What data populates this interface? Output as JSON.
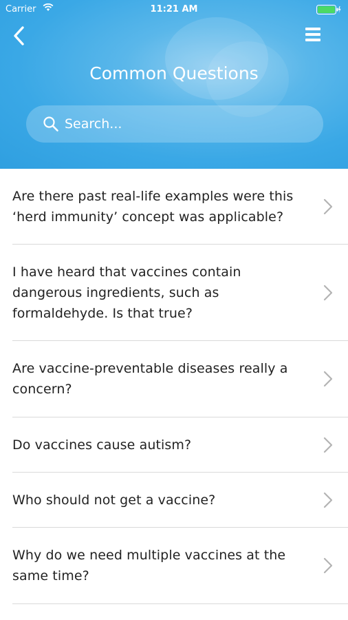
{
  "status_bar": {
    "carrier": "Carrier",
    "time": "11:21 AM"
  },
  "header": {
    "title": "Common Questions",
    "search_placeholder": "Search..."
  },
  "questions": [
    {
      "text": "Are there past real-life examples were this ‘herd immunity’ concept was applicable?"
    },
    {
      "text": "I have heard that vaccines contain dangerous ingredients, such as formaldehyde. Is that true?"
    },
    {
      "text": "Are vaccine-preventable diseases really a concern?"
    },
    {
      "text": "Do vaccines cause autism?"
    },
    {
      "text": "Who should not get a vaccine?"
    },
    {
      "text": "Why do we need multiple vaccines at the same time?"
    }
  ],
  "colors": {
    "header": "#3aa8e6",
    "battery": "#4cd964",
    "chevron": "#b3b3b3",
    "divider": "#d9d9d9"
  },
  "icons": [
    "wifi-icon",
    "battery-icon",
    "back-arrow-icon",
    "hamburger-menu-icon",
    "search-icon",
    "chevron-right-icon"
  ]
}
